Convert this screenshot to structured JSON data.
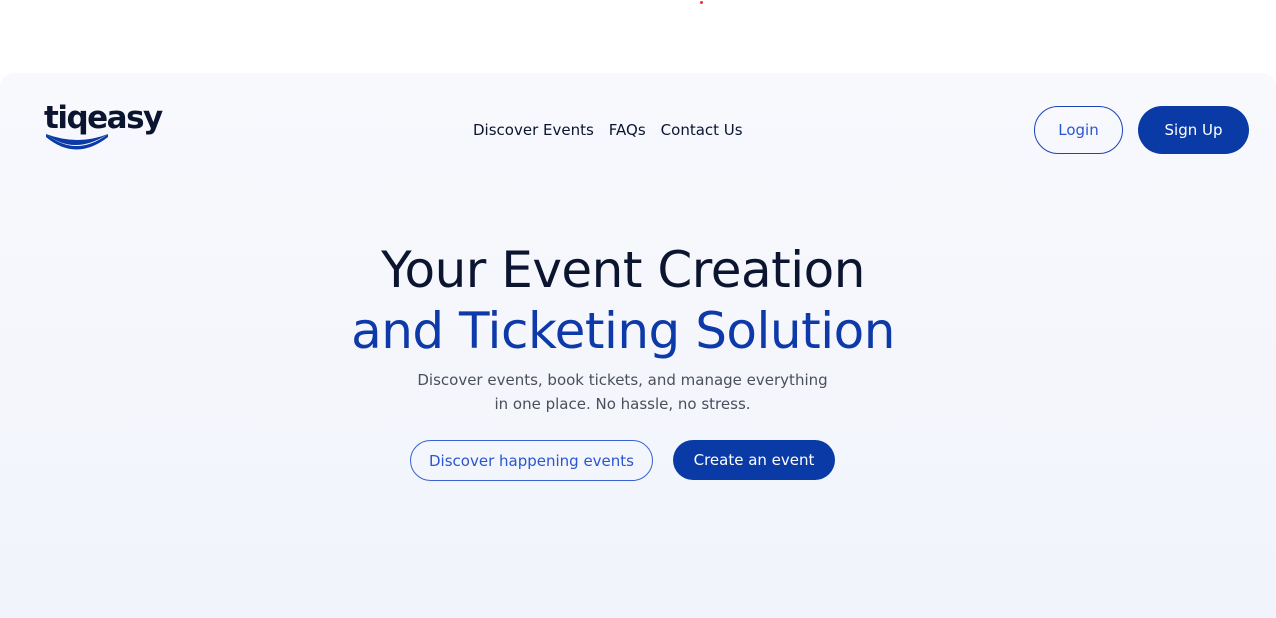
{
  "brand": {
    "name": "tiqeasy",
    "logo_color": "#0b1530",
    "smile_color": "#0a3aa6"
  },
  "nav": {
    "items": [
      "Discover Events",
      "FAQs",
      "Contact Us"
    ]
  },
  "auth": {
    "login_label": "Login",
    "signup_label": "Sign Up"
  },
  "hero": {
    "headline_line1": "Your Event Creation",
    "headline_line2": "and Ticketing Solution",
    "subtitle": "Discover events, book tickets, and manage everything in one place. No hassle, no stress.",
    "cta_secondary": "Discover happening events",
    "cta_primary": "Create an event"
  },
  "colors": {
    "primary": "#0a3aa6",
    "text_dark": "#0b1530",
    "text_muted": "#4a4f5c",
    "hero_bg": "#f3f5fb"
  }
}
